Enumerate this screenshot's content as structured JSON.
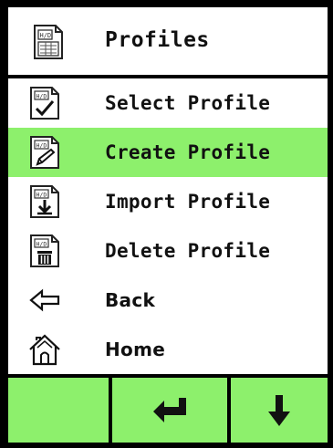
{
  "header": {
    "title": "Profiles",
    "icon": "profile-document-icon"
  },
  "menu": {
    "items": [
      {
        "label": "Select Profile",
        "icon": "profile-checkmark-icon",
        "selected": false
      },
      {
        "label": "Create Profile",
        "icon": "profile-pencil-icon",
        "selected": true
      },
      {
        "label": "Import Profile",
        "icon": "profile-import-icon",
        "selected": false
      },
      {
        "label": "Delete Profile",
        "icon": "profile-trash-icon",
        "selected": false
      },
      {
        "label": "Back",
        "icon": "back-arrow-icon",
        "selected": false
      },
      {
        "label": "Home",
        "icon": "home-icon",
        "selected": false
      }
    ]
  },
  "footer": {
    "buttons": [
      {
        "name": "empty-softkey",
        "icon": ""
      },
      {
        "name": "enter-button",
        "icon": "enter-arrow-icon"
      },
      {
        "name": "down-button",
        "icon": "down-arrow-icon"
      }
    ]
  },
  "colors": {
    "highlight": "#8df06c",
    "border": "#000000",
    "text": "#111111"
  }
}
